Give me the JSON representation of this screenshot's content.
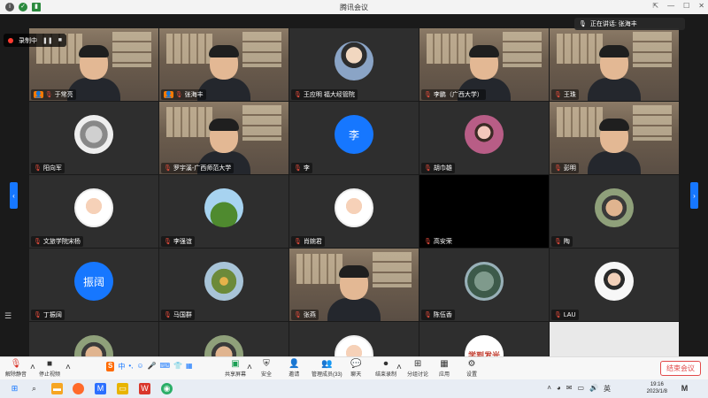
{
  "window": {
    "title": "腾讯会议"
  },
  "recording": {
    "label": "录制中",
    "pause_icon": "pause-icon",
    "stop_icon": "stop-icon"
  },
  "speaker": {
    "label": "正在讲话: 张海丰"
  },
  "participants": [
    {
      "name": "于常亮",
      "type": "cam",
      "host": true
    },
    {
      "name": "张海丰",
      "type": "cam",
      "host": true
    },
    {
      "name": "王应明 福大经管院",
      "type": "photo"
    },
    {
      "name": "李鹏（广西大学）",
      "type": "cam"
    },
    {
      "name": "王珠",
      "type": "cam"
    },
    {
      "name": "阳向军",
      "type": "hand"
    },
    {
      "name": "罗宇溪-广西师范大学",
      "type": "cam"
    },
    {
      "name": "李",
      "type": "blue",
      "initial": "李"
    },
    {
      "name": "胡巾雄",
      "type": "pink"
    },
    {
      "name": "彭明",
      "type": "cam"
    },
    {
      "name": "文旅学院宋杨",
      "type": "cartoon"
    },
    {
      "name": "李强谊",
      "type": "green"
    },
    {
      "name": "肖婉君",
      "type": "cartoon"
    },
    {
      "name": "高安荣",
      "type": "black"
    },
    {
      "name": "陶",
      "type": "face"
    },
    {
      "name": "丁振阔",
      "type": "blue",
      "initial": "振阔"
    },
    {
      "name": "马国群",
      "type": "flower"
    },
    {
      "name": "张燕",
      "type": "cam"
    },
    {
      "name": "陈伍香",
      "type": "pond"
    },
    {
      "name": "LAU",
      "type": "lau"
    },
    {
      "name": "",
      "type": "face"
    },
    {
      "name": "",
      "type": "face"
    },
    {
      "name": "",
      "type": "cartoon"
    },
    {
      "name": "",
      "type": "study",
      "initial": "学到发光"
    },
    {
      "name": "",
      "type": "light"
    }
  ],
  "toolbar": {
    "mute": "解除静音",
    "video": "停止视频",
    "share": "共享屏幕",
    "security": "安全",
    "invite": "邀请",
    "members": "管理成员(33)",
    "chat": "聊天",
    "record": "结束录制",
    "breakout": "分组讨论",
    "apps": "应用",
    "settings": "设置",
    "end": "结束会议"
  },
  "taskbar": {
    "time": "19:16",
    "date": "2023/1/8"
  }
}
